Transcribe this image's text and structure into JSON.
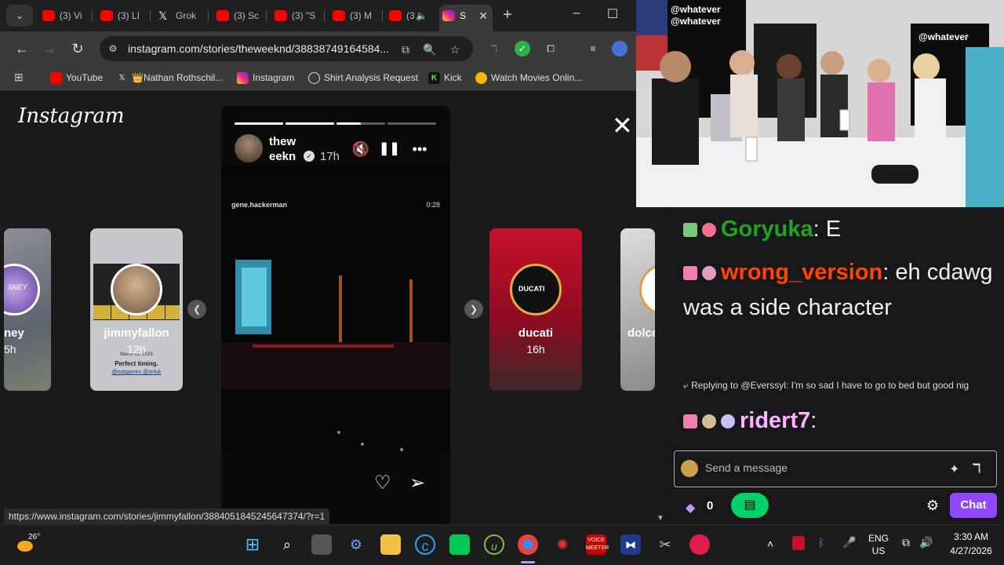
{
  "browser": {
    "tabs": [
      {
        "label": "(3) Vi",
        "icon": "youtube-icon"
      },
      {
        "label": "(3) LI",
        "icon": "youtube-icon"
      },
      {
        "label": "Grok",
        "icon": "x-icon"
      },
      {
        "label": "(3) Sc",
        "icon": "youtube-icon"
      },
      {
        "label": "(3) \"S",
        "icon": "youtube-icon"
      },
      {
        "label": "(3) M",
        "icon": "youtube-icon"
      },
      {
        "label": "(3",
        "icon": "youtube-icon"
      },
      {
        "label": "S",
        "icon": "instagram-icon"
      }
    ],
    "url": "instagram.com/stories/theweeknd/38838749164584...",
    "bookmarks": [
      {
        "label": "YouTube",
        "icon": "youtube-icon"
      },
      {
        "label": "👑Nathan Rothschil...",
        "icon": "x-icon"
      },
      {
        "label": "Instagram",
        "icon": "instagram-icon"
      },
      {
        "label": "Shirt Analysis Request",
        "icon": "openai-icon"
      },
      {
        "label": "Kick",
        "icon": "kick-icon"
      },
      {
        "label": "Watch Movies Onlin...",
        "icon": "movies-icon"
      }
    ],
    "status_url": "https://www.instagram.com/stories/jimmyfallon/3884051845245647374/?r=1"
  },
  "instagram": {
    "logo": "Instagram",
    "cards": [
      {
        "user": "ney",
        "age": "5h",
        "avatar_text": "SNEY"
      },
      {
        "user": "jimmyfallon",
        "age": "12h",
        "caption1": "Perfect timing.",
        "caption2": "@nytgames @snluk",
        "caption3": "March 21, 2026"
      },
      {
        "user": "ducati",
        "age": "16h",
        "avatar_text": "DUCATI"
      },
      {
        "user": "dolce",
        "age": ""
      }
    ],
    "story": {
      "user": "thew eekn",
      "time": "17h",
      "media_user": "gene.hackerman",
      "duration": "0:28",
      "progress": [
        1,
        1,
        0.5,
        0
      ]
    }
  },
  "webcam": {
    "banner": "@whatever"
  },
  "chat": {
    "messages": [
      {
        "user": "Goryuka",
        "color": "#1fa51f",
        "text": ": E"
      },
      {
        "user": "wrong_version",
        "color": "#ff4500",
        "text": ": eh cdawg was a side character"
      },
      {
        "user": "ridert7",
        "color": "#ffb3ff",
        "text": ":"
      }
    ],
    "reply": "Replying to @Everssyl: I'm so sad I have to go to bed but good nig",
    "placeholder": "Send a message",
    "points": "0",
    "chat_button": "Chat"
  },
  "taskbar": {
    "weather": "26°",
    "lang1": "ENG",
    "lang2": "US",
    "time": "3:30 AM",
    "date": "4/27/2026",
    "voicemeeter": "VOICE MEETER"
  },
  "colors": {
    "tabbar": "#1f1f1f",
    "toolbar": "#3a3a3a",
    "chat_bg": "#18181b",
    "accent_purple": "#9147ff",
    "accent_green": "#00d26a"
  }
}
